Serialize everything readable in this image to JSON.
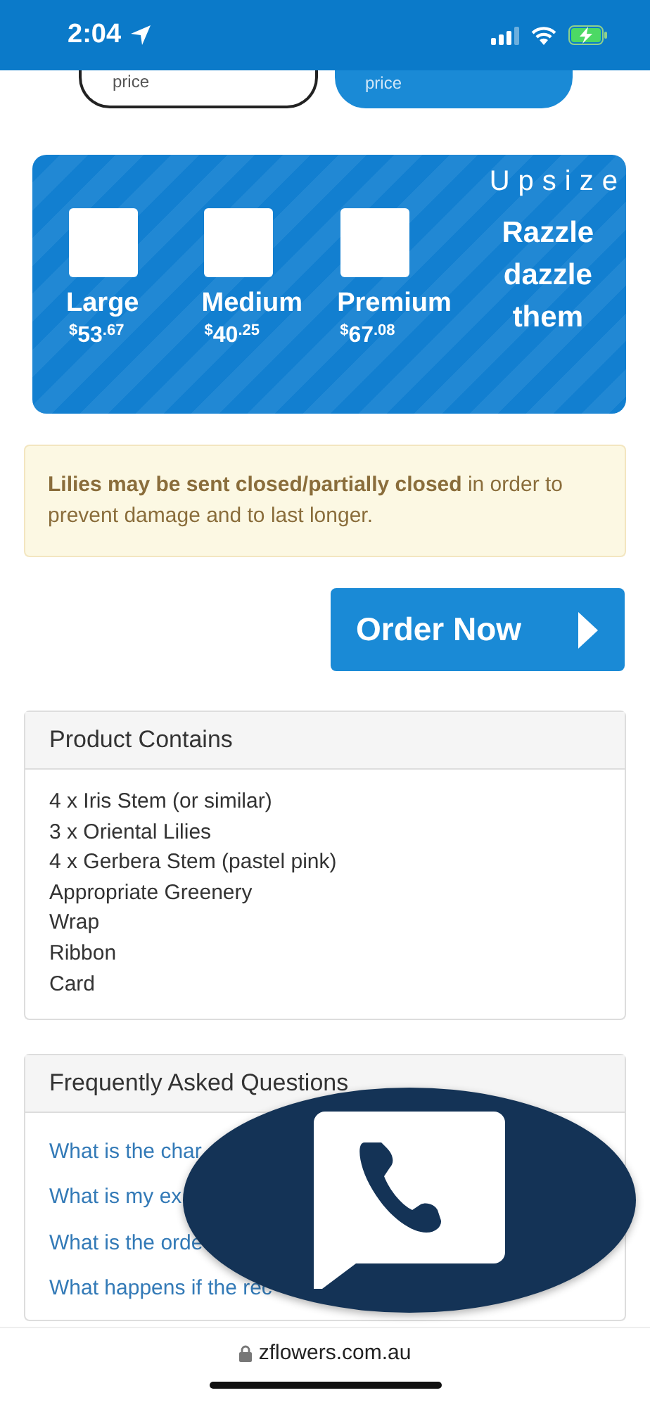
{
  "status_bar": {
    "time": "2:04",
    "battery_charging": true
  },
  "price_buttons": [
    {
      "label": "price",
      "selected": false
    },
    {
      "label": "price",
      "selected": true
    }
  ],
  "upsize": {
    "title": "Upsize",
    "tagline": "Razzle dazzle them",
    "options": [
      {
        "name": "Large",
        "currency": "$",
        "whole": "53",
        "cents": ".67",
        "checked": false
      },
      {
        "name": "Medium",
        "currency": "$",
        "whole": "40",
        "cents": ".25",
        "checked": false
      },
      {
        "name": "Premium",
        "currency": "$",
        "whole": "67",
        "cents": ".08",
        "checked": false
      }
    ]
  },
  "notice": "**Lilies may be sent closed/partially closed** in order to prevent damage and to last longer.",
  "order_button": {
    "label": "Order Now"
  },
  "product_contains": {
    "title": "Product Contains",
    "items": [
      "4 x Iris Stem (or similar)",
      "3 x Oriental Lilies",
      "4 x Gerbera Stem (pastel pink)",
      "Appropriate Greenery",
      "Wrap",
      "Ribbon",
      "Card"
    ]
  },
  "faq": {
    "title": "Frequently Asked Questions",
    "links": [
      "What is the char",
      "What is my ex",
      "What is the orde",
      "What happens if the rec"
    ]
  },
  "browser_bar": {
    "url": "zflowers.com.au"
  }
}
